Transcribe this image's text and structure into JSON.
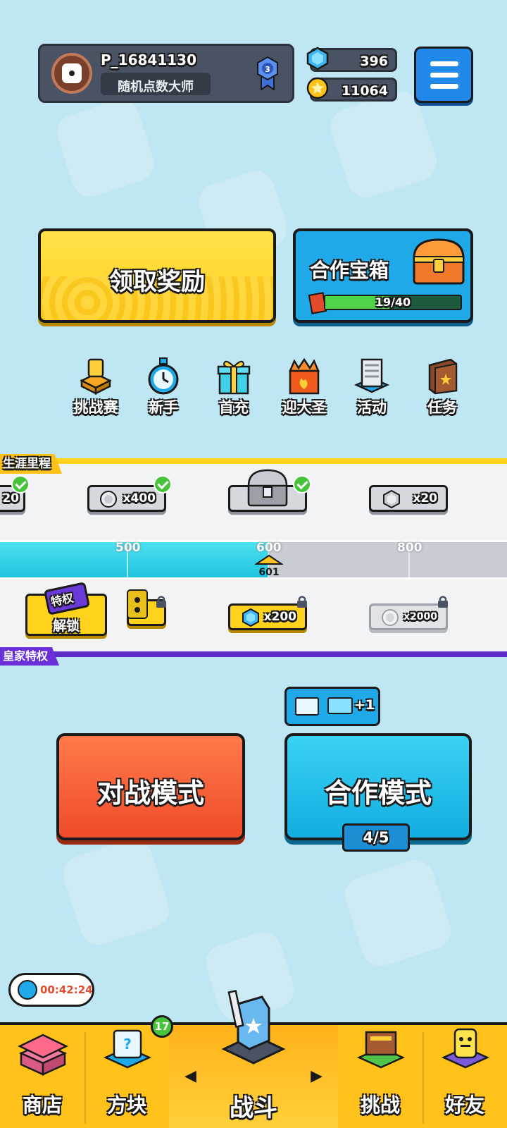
{
  "profile": {
    "player_name": "P_16841130",
    "title": "随机点数大师",
    "rank_level": "3"
  },
  "currency": {
    "gems": "396",
    "coins": "11064"
  },
  "rewards": {
    "claim_label": "领取奖励",
    "coop_chest_label": "合作宝箱",
    "coop_chest_progress_text": "19/40",
    "coop_chest_progress": 0.475
  },
  "activities": [
    {
      "label": "挑战赛",
      "icon": "challenge-trophy-icon"
    },
    {
      "label": "新手",
      "icon": "stopwatch-icon"
    },
    {
      "label": "首充",
      "icon": "gift-box-icon"
    },
    {
      "label": "迎大圣",
      "icon": "event-flame-icon"
    },
    {
      "label": "活动",
      "icon": "news-paper-icon"
    },
    {
      "label": "任务",
      "icon": "quest-book-icon"
    }
  ],
  "career": {
    "title": "生涯里程",
    "free_rewards": [
      {
        "qty": "20",
        "icon": "silver-coin-icon",
        "claimed": true
      },
      {
        "qty": "x400",
        "icon": "silver-coin-icon",
        "claimed": true
      },
      {
        "qty": "",
        "icon": "silver-chest-icon",
        "claimed": true
      },
      {
        "qty": "x20",
        "icon": "silver-gem-icon",
        "claimed": false
      }
    ],
    "milestones": [
      "500",
      "600",
      "800"
    ],
    "current_value": "601",
    "royal_title": "皇家特权",
    "unlock_badge": "特权",
    "unlock_label": "解锁",
    "royal_rewards": [
      {
        "qty": "",
        "icon": "gold-dice-icon",
        "locked": true
      },
      {
        "qty": "x200",
        "icon": "blue-gem-icon",
        "locked": true
      },
      {
        "qty": "x2000",
        "icon": "silver-coin-icon",
        "locked": true
      }
    ]
  },
  "modes": {
    "battle_label": "对战模式",
    "coop_label": "合作模式",
    "coop_count": "4/5",
    "ad_bonus": "+1"
  },
  "timer": {
    "text": "00:42:24"
  },
  "nav": {
    "shop": "商店",
    "blocks": "方块",
    "blocks_badge": "17",
    "battle": "战斗",
    "challenge": "挑战",
    "friends": "好友"
  },
  "colors": {
    "background": "#bfe6f3",
    "gold": "#ffd21c",
    "blue": "#1fa9e8",
    "red": "#ef4b2b",
    "royal_purple": "#5b2ac9"
  }
}
